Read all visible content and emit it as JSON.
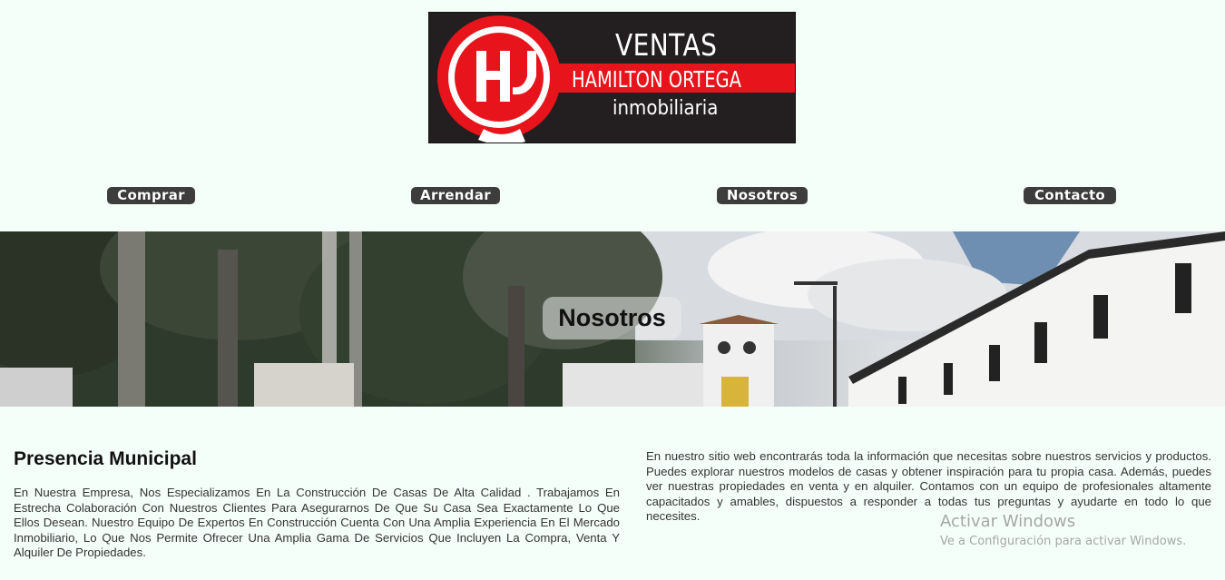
{
  "logo": {
    "line1": "VENTAS",
    "line2": "HAMILTON ORTEGA",
    "line3": "inmobiliaria",
    "monogram": "HO",
    "colors": {
      "background": "#231f20",
      "accent": "#e8141b",
      "text": "#ffffff"
    }
  },
  "nav": {
    "items": [
      {
        "label": "Comprar"
      },
      {
        "label": "Arrendar"
      },
      {
        "label": "Nosotros"
      },
      {
        "label": "Contacto"
      }
    ]
  },
  "banner": {
    "title": "Nosotros"
  },
  "content": {
    "heading": "Presencia Municipal",
    "left_paragraph": "En Nuestra Empresa, Nos Especializamos En La Construcción De Casas De Alta Calidad . Trabajamos En Estrecha Colaboración Con Nuestros Clientes Para Asegurarnos De Que Su Casa Sea Exactamente Lo Que Ellos Desean. Nuestro Equipo De Expertos En Construcción Cuenta Con Una Amplia Experiencia En El Mercado Inmobiliario, Lo Que Nos Permite Ofrecer Una Amplia Gama De Servicios Que Incluyen La Compra, Venta Y Alquiler De Propiedades.",
    "right_paragraph": "En nuestro sitio web encontrarás toda la información que necesitas sobre nuestros servicios y productos. Puedes explorar nuestros modelos de casas y obtener inspiración para tu propia casa. Además, puedes ver nuestras propiedades en venta y en alquiler. Contamos con un equipo de profesionales altamente capacitados y amables, dispuestos a responder a todas tus preguntas y ayudarte en todo lo que necesites."
  },
  "watermark": {
    "title": "Activar Windows",
    "subtitle": "Ve a Configuración para activar Windows."
  },
  "colors": {
    "page_background": "#f5fffa",
    "nav_button": "#3d3d3d",
    "nav_text": "#ffffff"
  }
}
